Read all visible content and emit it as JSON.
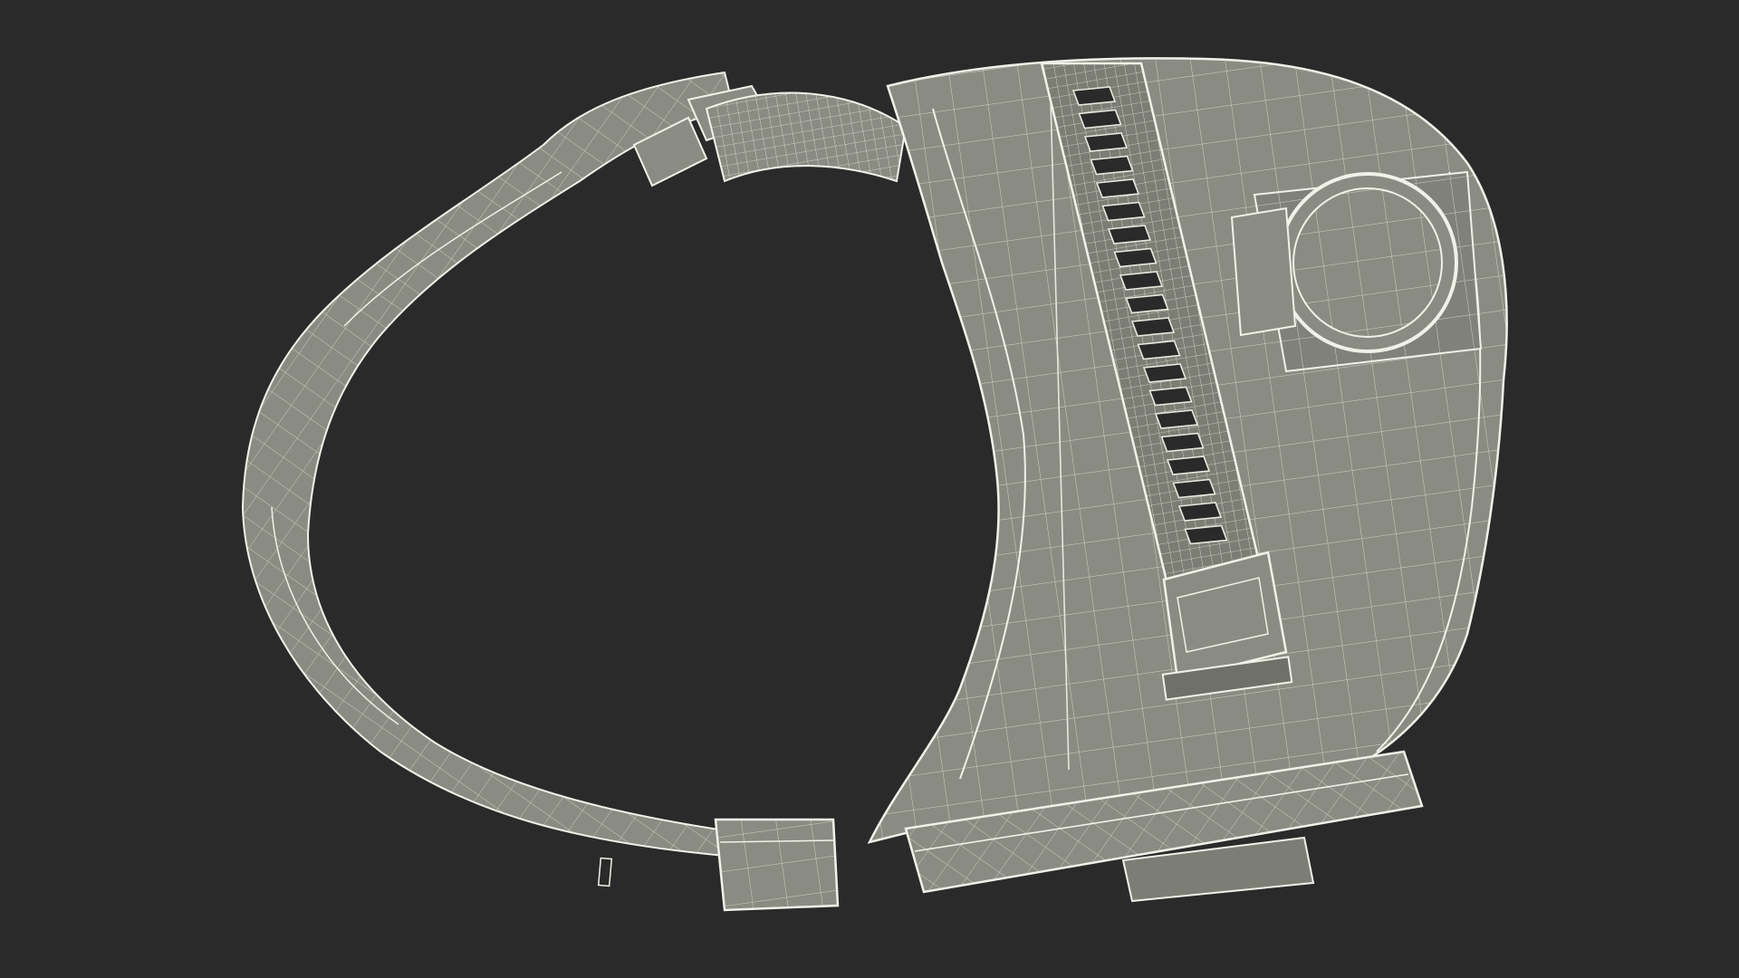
{
  "scene": {
    "background_color": "#2a2a2a",
    "model_fill_color": "#8a8b82",
    "model_shadow_color": "#6f7068",
    "wire_color": "#e8e9df",
    "subject": "wireframe-harness-3d-render"
  }
}
